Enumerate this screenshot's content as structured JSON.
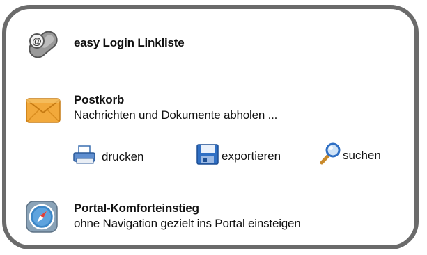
{
  "linklist": {
    "title": "easy Login Linkliste",
    "icon": "key-at-icon"
  },
  "postkorb": {
    "title": "Postkorb",
    "description": "Nachrichten und Dokumente abholen ...",
    "icon": "envelope-icon",
    "actions": [
      {
        "label": "drucken",
        "icon": "printer-icon"
      },
      {
        "label": "exportieren",
        "icon": "floppy-disk-icon"
      },
      {
        "label": "suchen",
        "icon": "magnifier-icon"
      }
    ]
  },
  "portal": {
    "title": "Portal-Komforteinstieg",
    "description": "ohne Navigation gezielt ins Portal einsteigen",
    "icon": "compass-icon"
  },
  "colors": {
    "border": "#6b6b6b",
    "envelope": "#f2a93b",
    "floppy": "#2f6fc4",
    "compass": "#3d87c7"
  }
}
